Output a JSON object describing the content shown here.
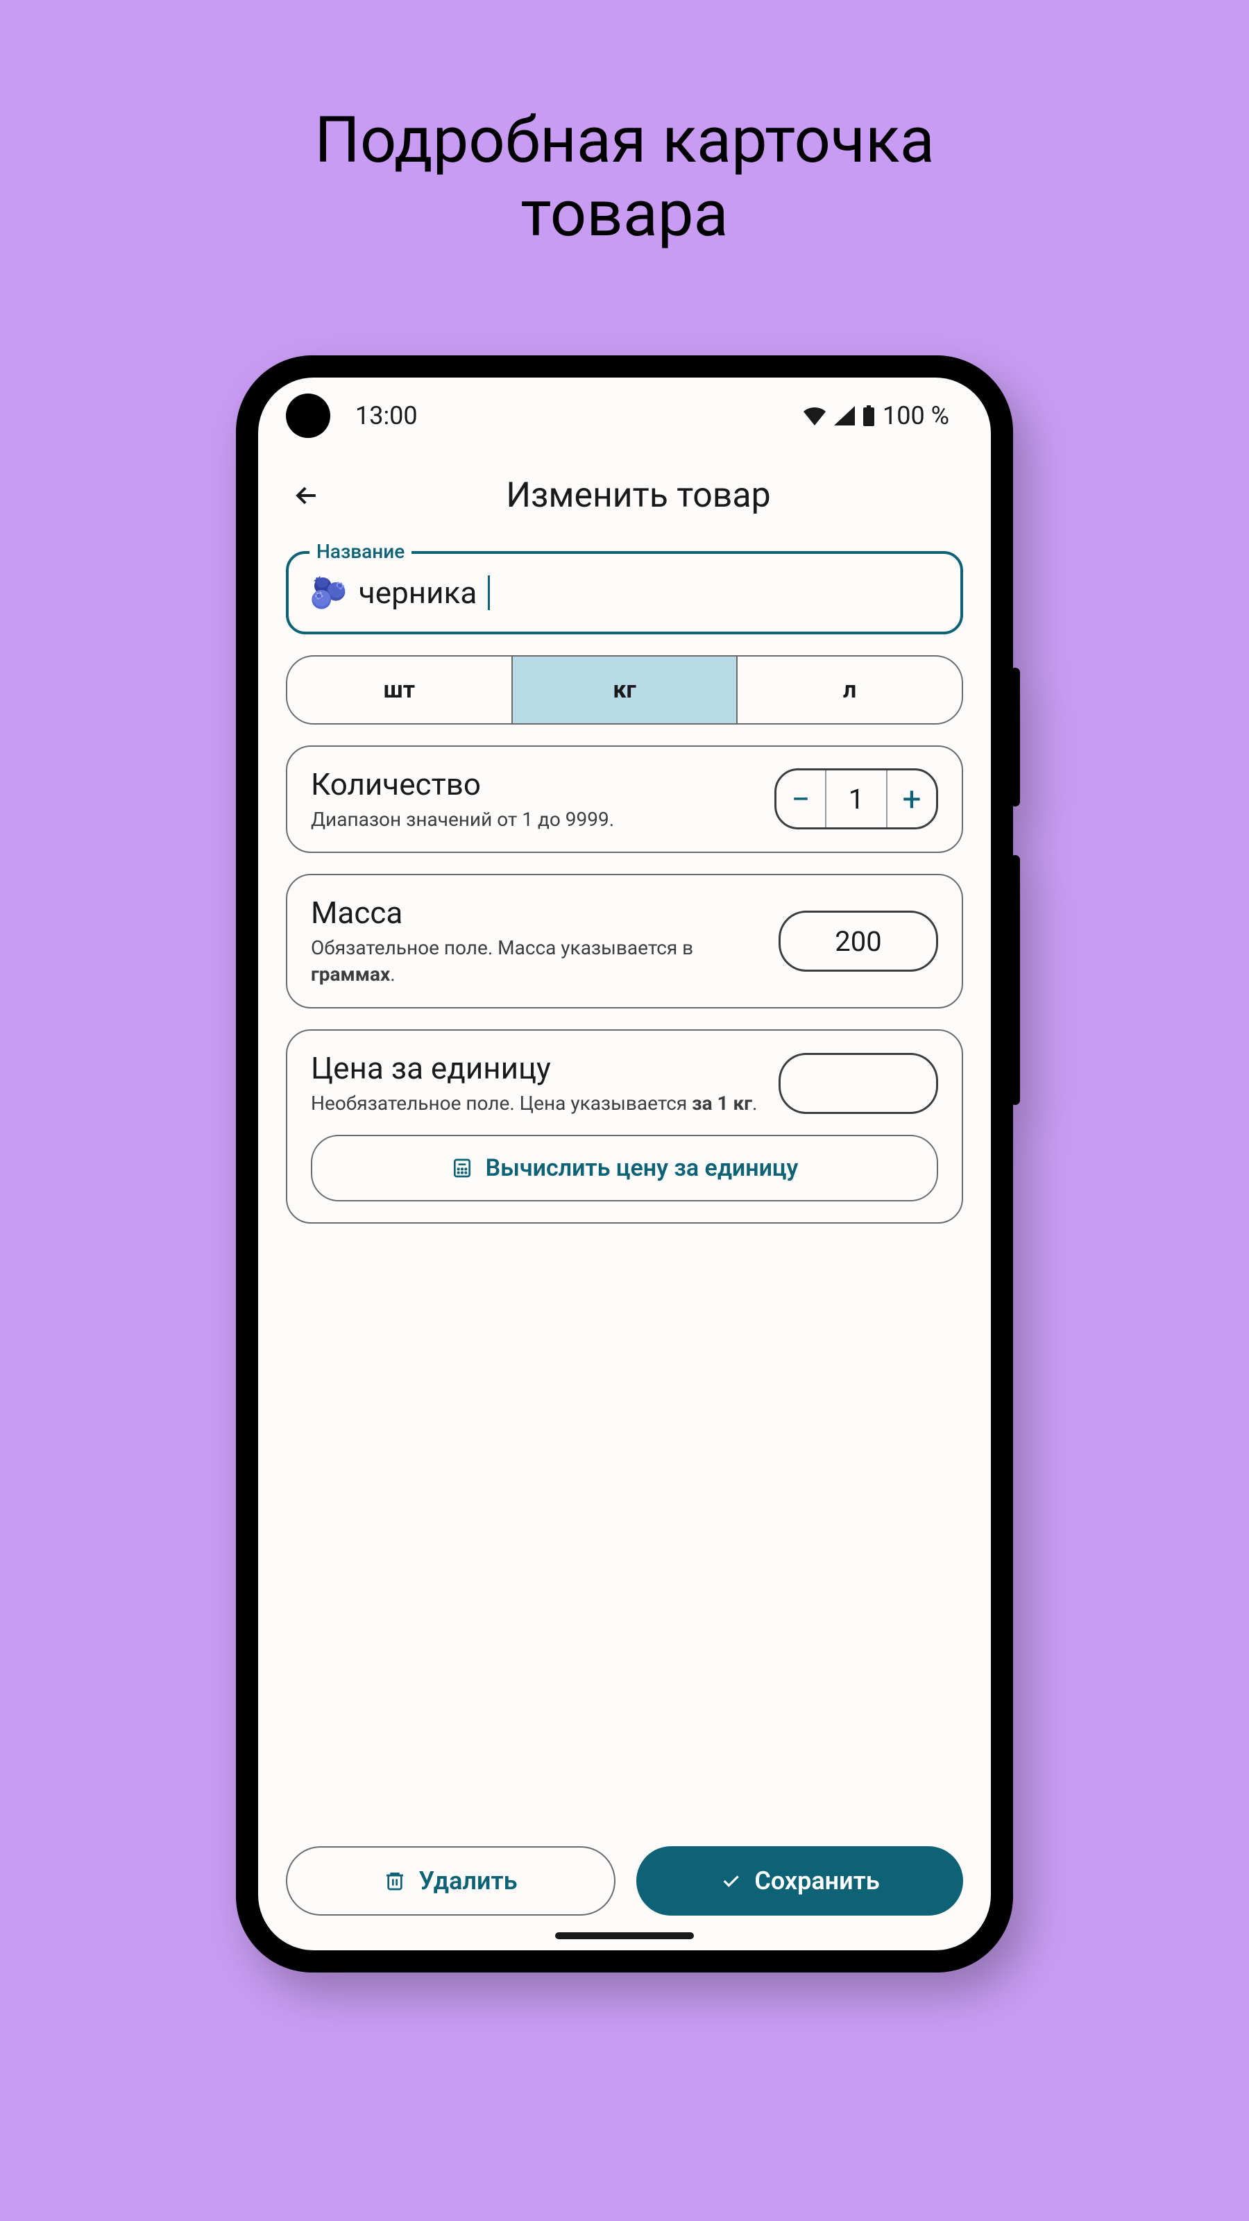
{
  "promo": {
    "line1": "Подробная карточка",
    "line2": "товара"
  },
  "statusbar": {
    "time": "13:00",
    "battery": "100 %"
  },
  "appbar": {
    "title": "Изменить товар"
  },
  "name_field": {
    "label": "Название",
    "emoji": "🫐",
    "value": "черника"
  },
  "units": {
    "opt1": "шт",
    "opt2": "кг",
    "opt3": "л"
  },
  "quantity": {
    "title": "Количество",
    "sub": "Диапазон значений от 1 до 9999.",
    "value": "1"
  },
  "mass": {
    "title": "Масса",
    "sub_prefix": "Обязательное поле. Масса указывается в ",
    "sub_bold": "граммах",
    "sub_suffix": ".",
    "value": "200"
  },
  "price": {
    "title": "Цена за единицу",
    "sub_prefix": "Необязательное поле. Цена указывается ",
    "sub_bold": "за 1 кг",
    "sub_suffix": ".",
    "value": ""
  },
  "calc": {
    "label": "Вычислить цену за единицу"
  },
  "footer": {
    "delete": "Удалить",
    "save": "Сохранить"
  }
}
